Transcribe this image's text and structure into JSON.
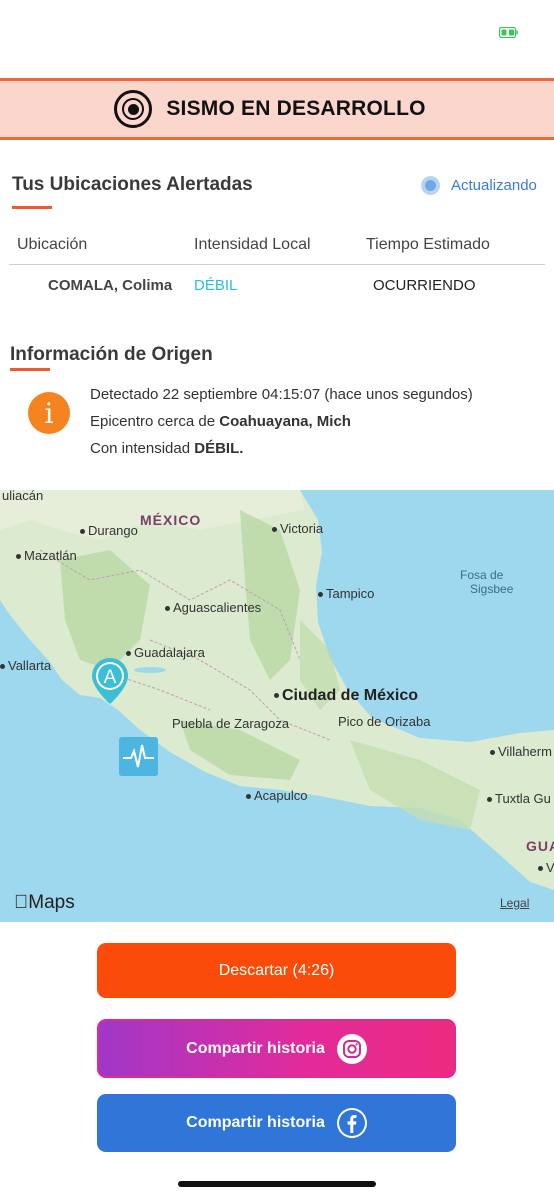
{
  "banner": {
    "title": "SISMO EN DESARROLLO"
  },
  "locations": {
    "title": "Tus Ubicaciones Alertadas",
    "status": "Actualizando",
    "columns": [
      "Ubicación",
      "Intensidad Local",
      "Tiempo Estimado"
    ],
    "rows": [
      {
        "location": "COMALA, Colima",
        "intensity": "DÉBIL",
        "time": "OCURRIENDO"
      }
    ]
  },
  "origin": {
    "title": "Información de Origen",
    "detected": "Detectado 22 septiembre 04:15:07 (hace unos segundos)",
    "epicenter_prefix": "Epicentro cerca de ",
    "epicenter_place": "Coahuayana, Mich",
    "intensity_prefix": "Con intensidad ",
    "intensity_value": "DÉBIL."
  },
  "map": {
    "labels": {
      "culiacan": "uliacán",
      "mexico": "MÉXICO",
      "durango": "Durango",
      "mazatlan": "Mazatlán",
      "victoria": "Victoria",
      "tampico": "Tampico",
      "fosa": "Fosa de",
      "sigsbee": "Sigsbee",
      "aguascalientes": "Aguascalientes",
      "guadalajara": "Guadalajara",
      "vallarta": "Vallarta",
      "cdmx": "Ciudad de México",
      "puebla": "Puebla de Zaragoza",
      "orizaba": "Pico de Orizaba",
      "villahermosa": "Villaherm",
      "acapulco": "Acapulco",
      "tuxtla": "Tuxtla Gu",
      "gua": "GUA",
      "vo": "Vo"
    },
    "pin_letter": "A",
    "brand": "Maps",
    "legal": "Legal"
  },
  "buttons": {
    "discard": "Descartar (4:26)",
    "share_instagram": "Compartir historia",
    "share_facebook": "Compartir historia"
  },
  "colors": {
    "accent_orange": "#fa4b0b",
    "banner_bg": "#fbd6cd",
    "intensity_weak": "#2bbfd6",
    "facebook_blue": "#2f76d8"
  }
}
